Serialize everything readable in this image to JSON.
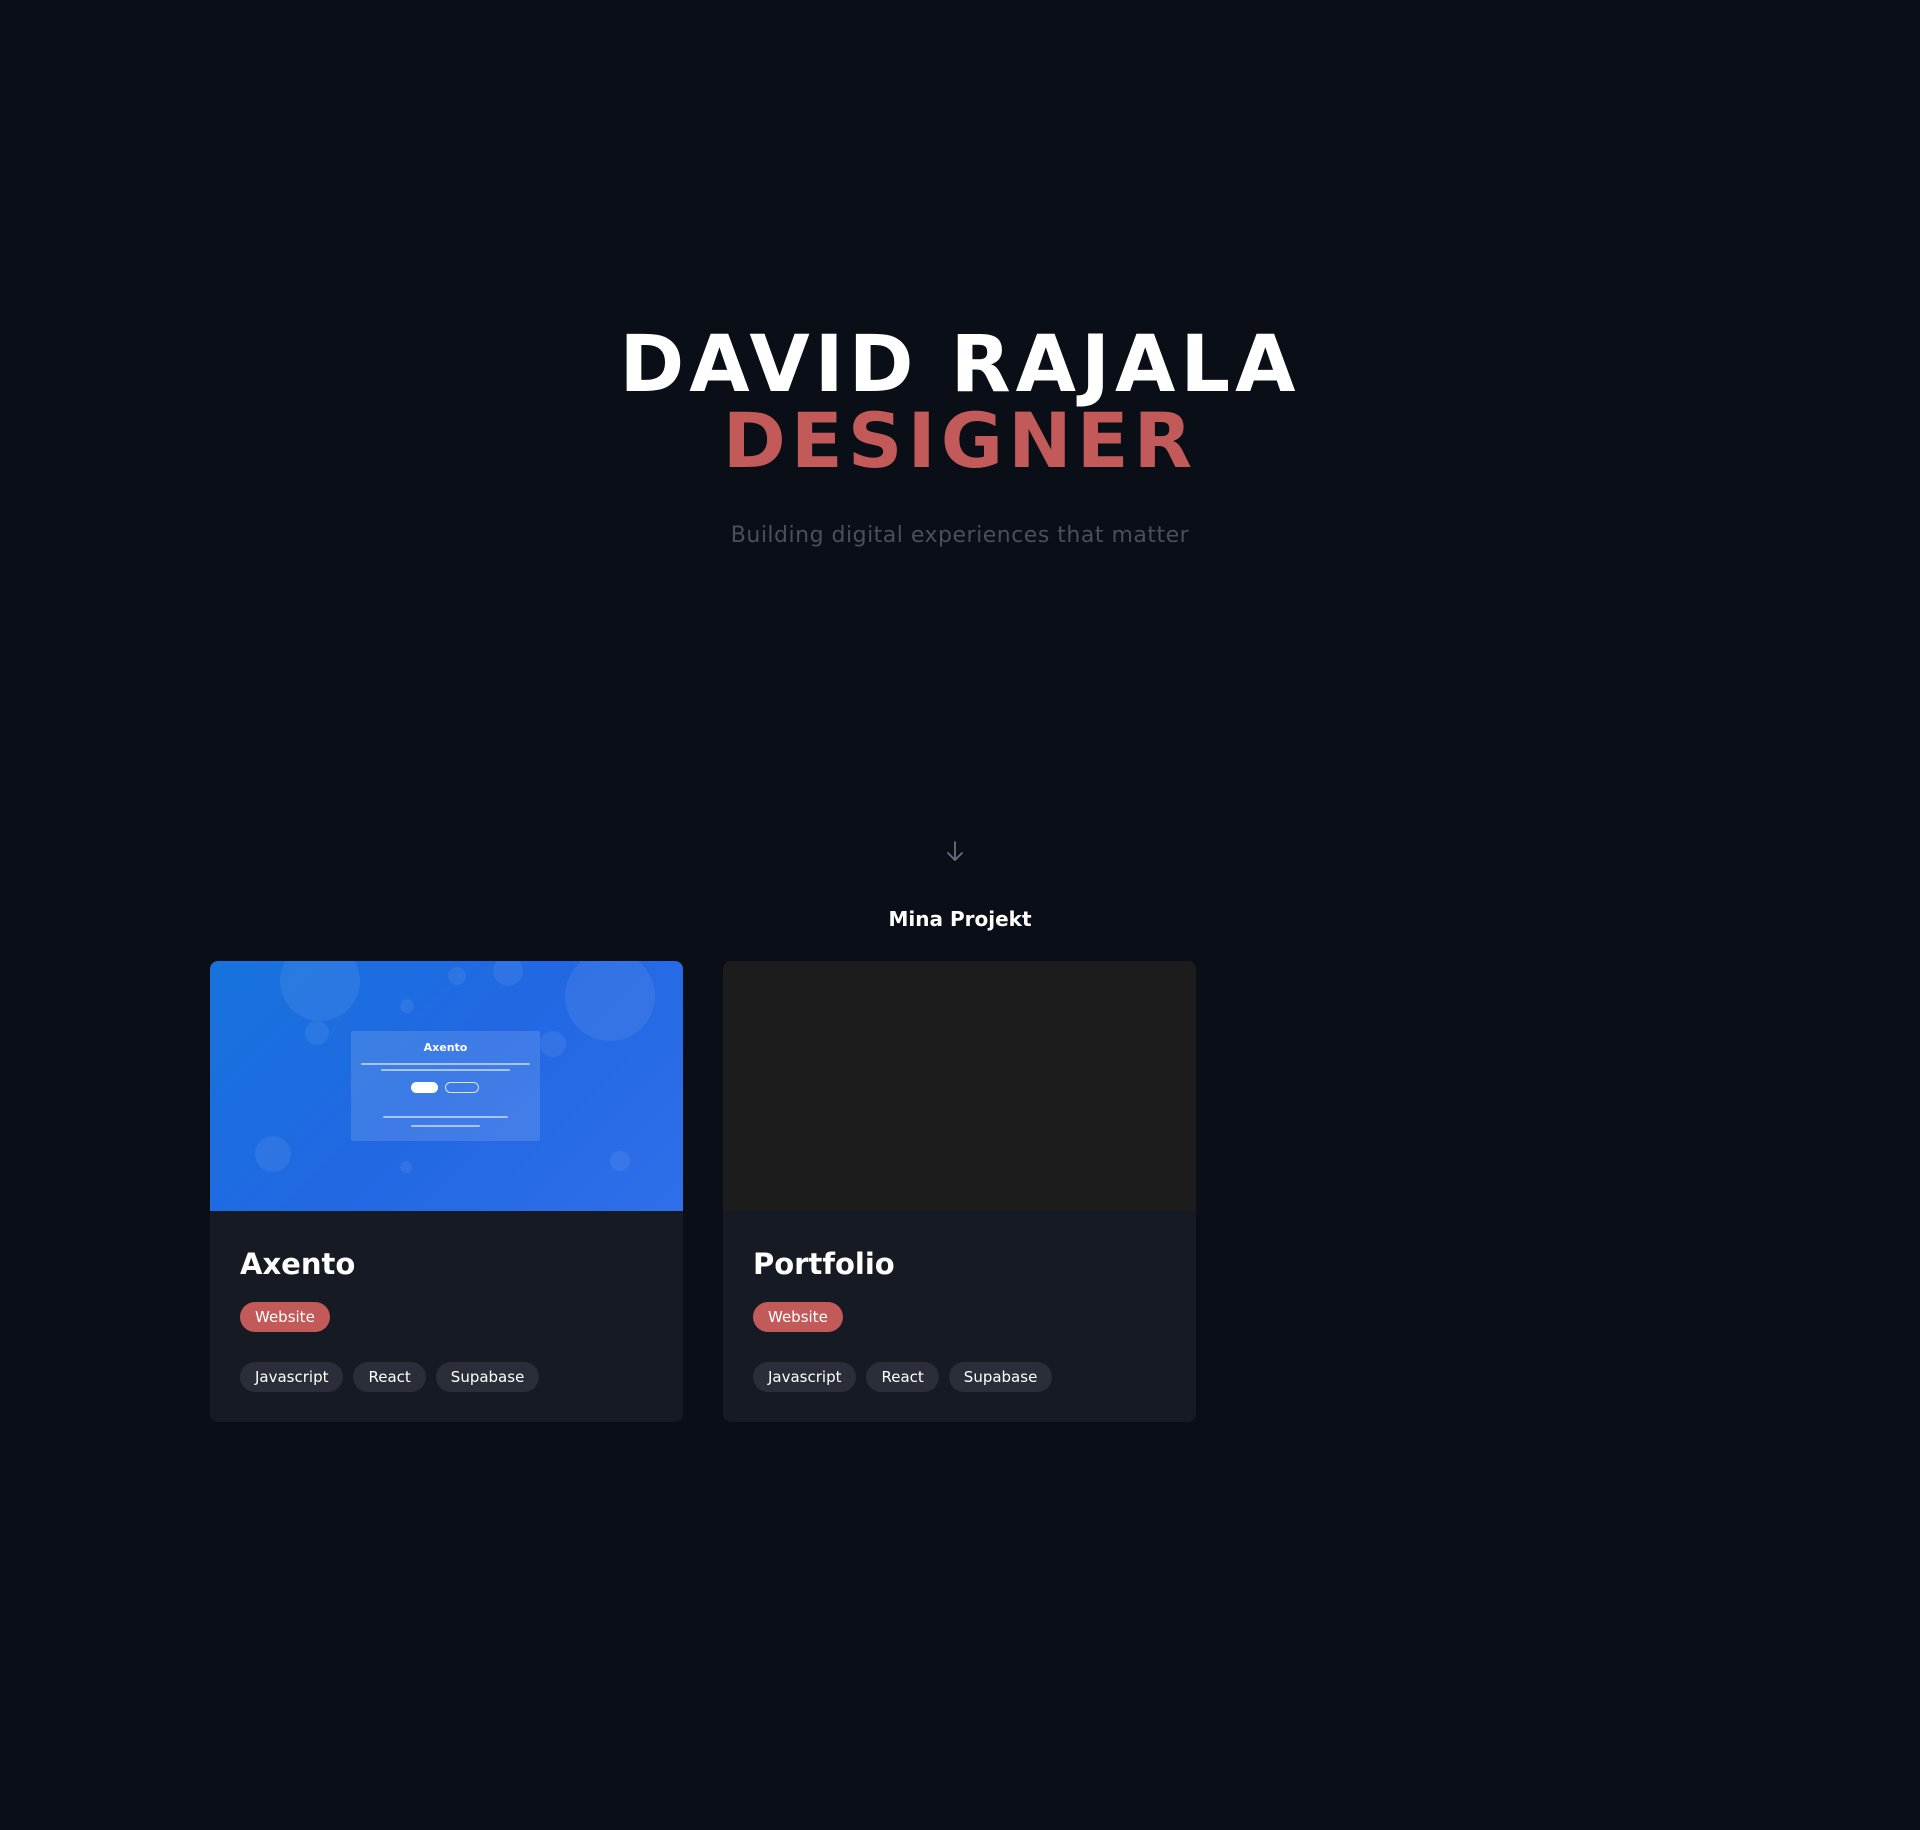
{
  "hero": {
    "name": "DAVID RAJALA",
    "role": "DESIGNER",
    "tagline": "Building digital experiences that matter"
  },
  "projects_section": {
    "title": "Mina Projekt",
    "projects": [
      {
        "title": "Axento",
        "category": "Website",
        "preview_title": "Axento",
        "tech": [
          "Javascript",
          "React",
          "Supabase"
        ]
      },
      {
        "title": "Portfolio",
        "category": "Website",
        "tech": [
          "Javascript",
          "React",
          "Supabase"
        ]
      }
    ]
  },
  "icons": {
    "scroll": "arrow-down-icon"
  },
  "colors": {
    "background": "#0a0e16",
    "accent": "#c25a5a",
    "card": "#161a23",
    "tag": "#2a2e38",
    "tagline": "#4a4f5b"
  }
}
